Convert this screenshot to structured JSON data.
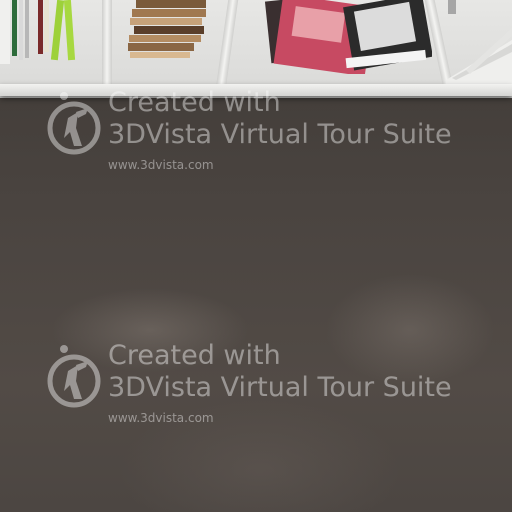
{
  "scene": {
    "description_tag": "",
    "colors": {
      "floor": "#4a4440",
      "shelf": "#e3e3e1",
      "watermark_text": "#ffffff"
    }
  },
  "watermarks": [
    {
      "line1": "Created with",
      "line2": "3DVista Virtual Tour Suite",
      "url": "www.3dvista.com",
      "logo_icon": "3dvista-logo-icon"
    },
    {
      "line1": "Created with",
      "line2": "3DVista Virtual Tour Suite",
      "url": "www.3dvista.com",
      "logo_icon": "3dvista-logo-icon"
    }
  ]
}
